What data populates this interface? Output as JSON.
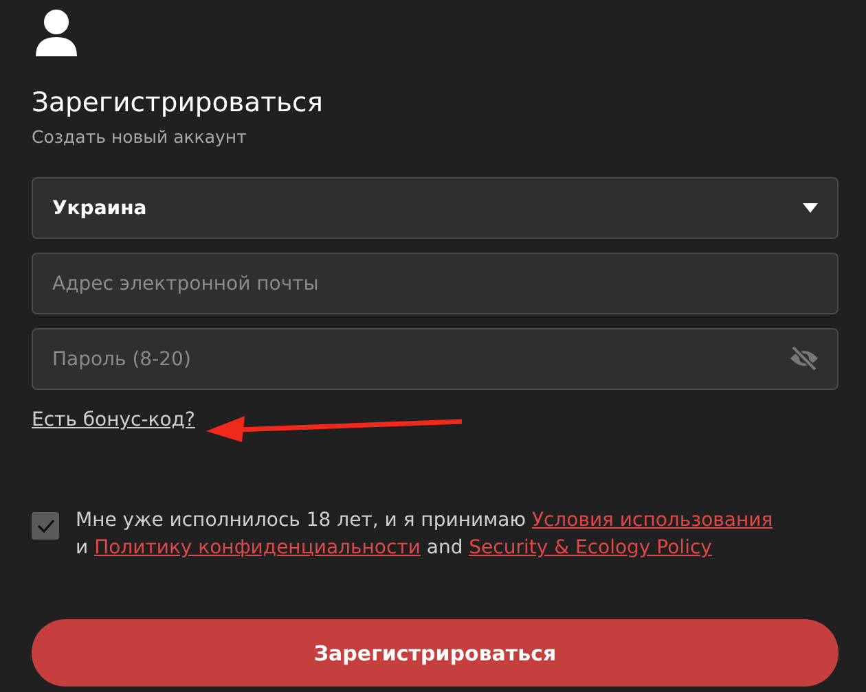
{
  "header": {
    "title": "Зарегистрироваться",
    "subtitle": "Создать новый аккаунт"
  },
  "country_select": {
    "value": "Украина"
  },
  "email_field": {
    "placeholder": "Адрес электронной почты"
  },
  "password_field": {
    "placeholder": "Пароль (8-20)",
    "visible": false
  },
  "bonus_link": "Есть бонус-код?",
  "agreement": {
    "checked": true,
    "parts": [
      {
        "kind": "text",
        "text": "Мне уже исполнилось 18 лет, и я принимаю "
      },
      {
        "kind": "link",
        "text": "Условия использования"
      },
      {
        "kind": "text",
        "text": " и "
      },
      {
        "kind": "link",
        "text": "Политику конфиденциальности"
      },
      {
        "kind": "text",
        "text": " and "
      },
      {
        "kind": "link",
        "text": "Security & Ecology Policy"
      }
    ]
  },
  "submit_button": "Зарегистрироваться"
}
